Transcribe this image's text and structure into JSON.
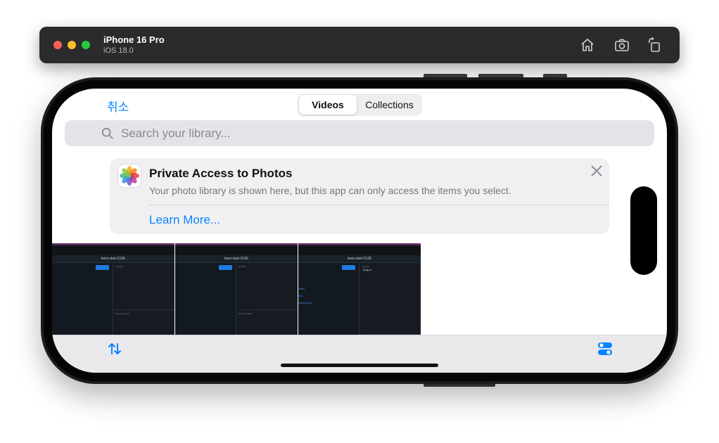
{
  "simulator": {
    "device_name": "iPhone 16 Pro",
    "os_version": "iOS 18.0",
    "buttons": [
      "home-icon",
      "screenshot-icon",
      "rotate-icon"
    ]
  },
  "app": {
    "cancel_label": "취소",
    "segments": {
      "videos": "Videos",
      "collections": "Collections",
      "selected": "Videos"
    },
    "search": {
      "placeholder": "Search your library...",
      "value": ""
    },
    "banner": {
      "title": "Private Access to Photos",
      "text": "Your photo library is shown here, but this app can only access the items you select.",
      "link": "Learn More...",
      "icon": "photos-app-icon",
      "close_icon": "close-icon"
    },
    "thumbnails": [
      {
        "project": "keen-dart-5136",
        "run": "Run",
        "console_label": "Console",
        "docs_label": "Documentation",
        "console_text": "",
        "code_lines": []
      },
      {
        "project": "keen-dart-5136",
        "run": "Run",
        "console_label": "Console",
        "docs_label": "Documentation",
        "console_text": "",
        "code_lines": []
      },
      {
        "project": "keen-dart-5136",
        "run": "Run",
        "console_label": "Console",
        "docs_label": "",
        "console_text": "복어음 20",
        "code_lines": [
          "Hello",
          "011",
          "Develop10"
        ]
      }
    ],
    "toolbar": {
      "sort_icon": "sort-arrows-icon",
      "filter_icon": "filter-toggle-icon"
    }
  },
  "colors": {
    "accent": "#0a84ff",
    "sim_bar": "#2b2b2d",
    "thumb_bg": "#141a20"
  }
}
